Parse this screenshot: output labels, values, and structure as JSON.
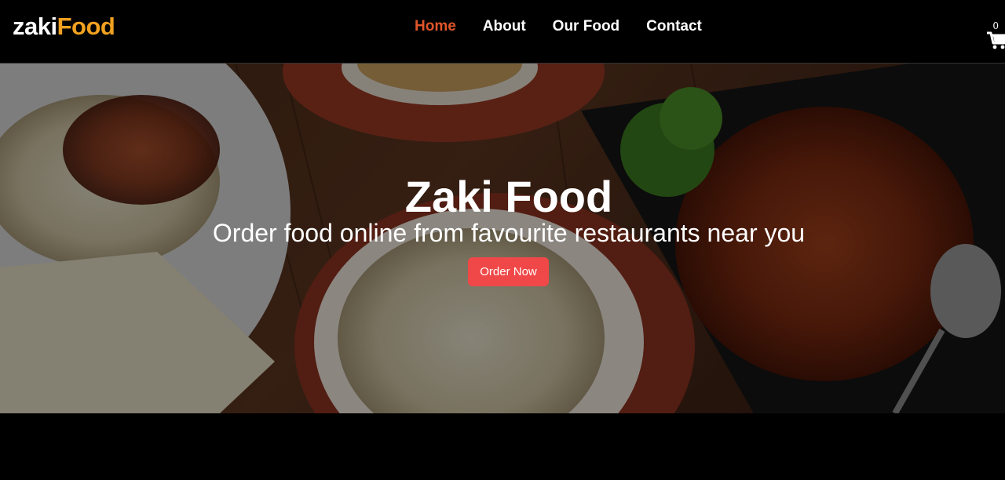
{
  "brand": {
    "part1": "zaki",
    "part2": "Food"
  },
  "nav": {
    "items": [
      {
        "label": "Home",
        "active": true
      },
      {
        "label": "About",
        "active": false
      },
      {
        "label": "Our Food",
        "active": false
      },
      {
        "label": "Contact",
        "active": false
      }
    ]
  },
  "cart": {
    "count": "0",
    "icon": "cart-icon"
  },
  "hero": {
    "title": "Zaki Food",
    "subtitle": "Order food online from favourite restaurants near you",
    "cta_label": "Order Now"
  },
  "colors": {
    "accent": "#e0552a",
    "brand_orange": "#f0a020",
    "button": "#f04848",
    "background": "#000000"
  }
}
